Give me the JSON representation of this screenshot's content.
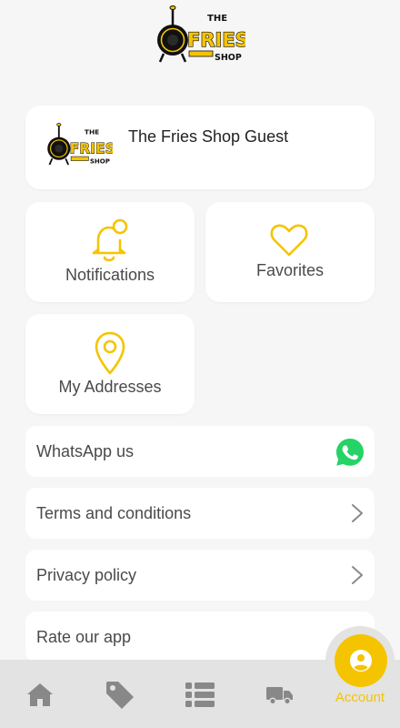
{
  "brand": {
    "logo_the": "THE",
    "logo_fries": "FRIES",
    "logo_shop": "SHOP"
  },
  "profile": {
    "name": "The Fries Shop Guest"
  },
  "tiles": {
    "notifications": "Notifications",
    "favorites": "Favorites",
    "addresses": "My Addresses"
  },
  "menu": {
    "whatsapp": "WhatsApp us",
    "terms": "Terms and conditions",
    "privacy": "Privacy policy",
    "rate": "Rate our app"
  },
  "nav": {
    "items": [
      {
        "icon": "home-icon",
        "active": false
      },
      {
        "icon": "tag-icon",
        "active": false
      },
      {
        "icon": "list-icon",
        "active": false
      },
      {
        "icon": "truck-icon",
        "active": false
      },
      {
        "icon": "user-icon",
        "label": "Account",
        "active": true
      }
    ]
  },
  "colors": {
    "accent": "#f5c400",
    "background": "#f6f6f6",
    "card": "#ffffff",
    "nav_background": "#e3e3e3",
    "nav_icon": "#888888",
    "whatsapp": "#25d366"
  }
}
